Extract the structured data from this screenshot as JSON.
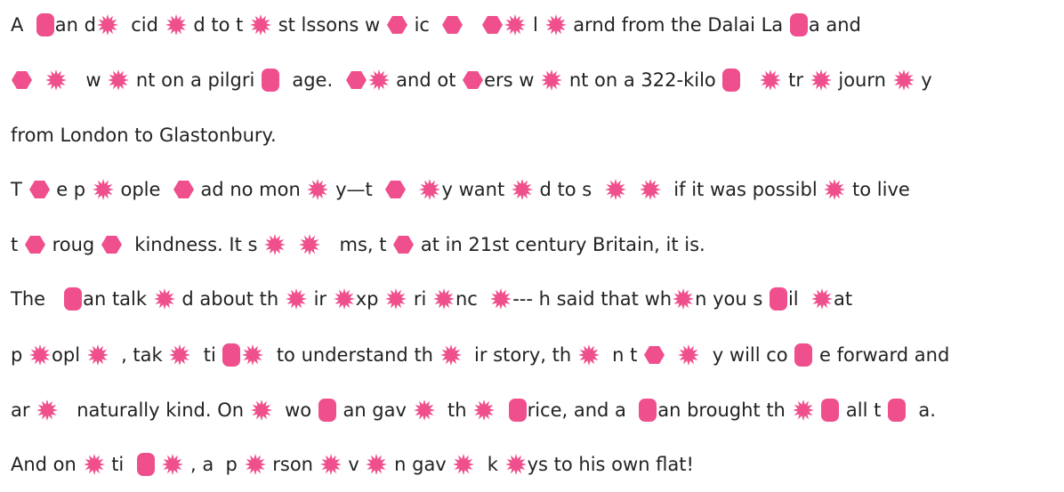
{
  "colors": {
    "text": "#222222",
    "blot": "#ef4f8c",
    "background": "#ffffff"
  },
  "icons": {
    "star": "starburst-blot-icon",
    "hex": "hexagon-blot-icon",
    "pill": "rounded-rect-blot-icon"
  },
  "lines": [
    [
      {
        "t": "A  "
      },
      {
        "i": "pill"
      },
      {
        "t": "an d"
      },
      {
        "i": "star"
      },
      {
        "t": "  cid "
      },
      {
        "i": "star"
      },
      {
        "t": " d to t "
      },
      {
        "i": "star"
      },
      {
        "t": " st lssons w "
      },
      {
        "i": "hex"
      },
      {
        "t": " ic  "
      },
      {
        "i": "hex"
      },
      {
        "t": "   "
      },
      {
        "i": "hex"
      },
      {
        "i": "star"
      },
      {
        "t": " l "
      },
      {
        "i": "star"
      },
      {
        "t": " arnd from the Dalai La "
      },
      {
        "i": "pill"
      },
      {
        "t": "a and"
      }
    ],
    [
      {
        "i": "hex"
      },
      {
        "t": "  "
      },
      {
        "i": "star"
      },
      {
        "t": "   w "
      },
      {
        "i": "star"
      },
      {
        "t": " nt on a pilgri "
      },
      {
        "i": "pill"
      },
      {
        "t": "  age.  "
      },
      {
        "i": "hex"
      },
      {
        "i": "star"
      },
      {
        "t": " and ot "
      },
      {
        "i": "hex"
      },
      {
        "t": "ers w "
      },
      {
        "i": "star"
      },
      {
        "t": " nt on a 322-kilo "
      },
      {
        "i": "pill"
      },
      {
        "t": "   "
      },
      {
        "i": "star"
      },
      {
        "t": " tr "
      },
      {
        "i": "star"
      },
      {
        "t": " journ "
      },
      {
        "i": "star"
      },
      {
        "t": " y"
      }
    ],
    [
      {
        "t": "from London to Glastonbury."
      }
    ],
    [
      {
        "t": "T "
      },
      {
        "i": "hex"
      },
      {
        "t": " e p "
      },
      {
        "i": "star"
      },
      {
        "t": " ople  "
      },
      {
        "i": "hex"
      },
      {
        "t": " ad no mon "
      },
      {
        "i": "star"
      },
      {
        "t": " y—t  "
      },
      {
        "i": "hex"
      },
      {
        "t": "  "
      },
      {
        "i": "star"
      },
      {
        "t": "y want "
      },
      {
        "i": "star"
      },
      {
        "t": " d to s  "
      },
      {
        "i": "star"
      },
      {
        "t": "  "
      },
      {
        "i": "star"
      },
      {
        "t": "  if it was possibl "
      },
      {
        "i": "star"
      },
      {
        "t": " to live"
      }
    ],
    [
      {
        "t": "t "
      },
      {
        "i": "hex"
      },
      {
        "t": " roug "
      },
      {
        "i": "hex"
      },
      {
        "t": "  kindness. It s "
      },
      {
        "i": "star"
      },
      {
        "t": "  "
      },
      {
        "i": "star"
      },
      {
        "t": "   ms, t "
      },
      {
        "i": "hex"
      },
      {
        "t": " at in 21st century Britain, it is."
      }
    ],
    [
      {
        "t": "The   "
      },
      {
        "i": "pill"
      },
      {
        "t": "an talk "
      },
      {
        "i": "star"
      },
      {
        "t": " d about th "
      },
      {
        "i": "star"
      },
      {
        "t": " ir "
      },
      {
        "i": "star"
      },
      {
        "t": "xp "
      },
      {
        "i": "star"
      },
      {
        "t": " ri "
      },
      {
        "i": "star"
      },
      {
        "t": "nc  "
      },
      {
        "i": "star"
      },
      {
        "t": "--- h said that wh"
      },
      {
        "i": "star"
      },
      {
        "t": "n you s "
      },
      {
        "i": "pill"
      },
      {
        "t": "il  "
      },
      {
        "i": "star"
      },
      {
        "t": "at"
      }
    ],
    [
      {
        "t": "p "
      },
      {
        "i": "star"
      },
      {
        "t": "opl "
      },
      {
        "i": "star"
      },
      {
        "t": "  , tak "
      },
      {
        "i": "star"
      },
      {
        "t": "  ti "
      },
      {
        "i": "pill"
      },
      {
        "i": "star"
      },
      {
        "t": "  to understand th "
      },
      {
        "i": "star"
      },
      {
        "t": "  ir story, th "
      },
      {
        "i": "star"
      },
      {
        "t": "  n t "
      },
      {
        "i": "hex"
      },
      {
        "t": "  "
      },
      {
        "i": "star"
      },
      {
        "t": "  y will co "
      },
      {
        "i": "pill"
      },
      {
        "t": " e forward and"
      }
    ],
    [
      {
        "t": "ar "
      },
      {
        "i": "star"
      },
      {
        "t": "   naturally kind. On "
      },
      {
        "i": "star"
      },
      {
        "t": "  wo "
      },
      {
        "i": "pill"
      },
      {
        "t": " an gav "
      },
      {
        "i": "star"
      },
      {
        "t": "  th "
      },
      {
        "i": "star"
      },
      {
        "t": "  "
      },
      {
        "i": "pill"
      },
      {
        "t": "rice, and a  "
      },
      {
        "i": "pill"
      },
      {
        "t": "an brought th "
      },
      {
        "i": "star"
      },
      {
        "t": " "
      },
      {
        "i": "pill"
      },
      {
        "t": " all t "
      },
      {
        "i": "pill"
      },
      {
        "t": "  a."
      }
    ],
    [
      {
        "t": "And on "
      },
      {
        "i": "star"
      },
      {
        "t": " ti  "
      },
      {
        "i": "pill"
      },
      {
        "t": " "
      },
      {
        "i": "star"
      },
      {
        "t": " , a  p "
      },
      {
        "i": "star"
      },
      {
        "t": " rson "
      },
      {
        "i": "star"
      },
      {
        "t": " v "
      },
      {
        "i": "star"
      },
      {
        "t": " n gav "
      },
      {
        "i": "star"
      },
      {
        "t": "  k "
      },
      {
        "i": "star"
      },
      {
        "t": "ys to his own flat!"
      }
    ]
  ]
}
